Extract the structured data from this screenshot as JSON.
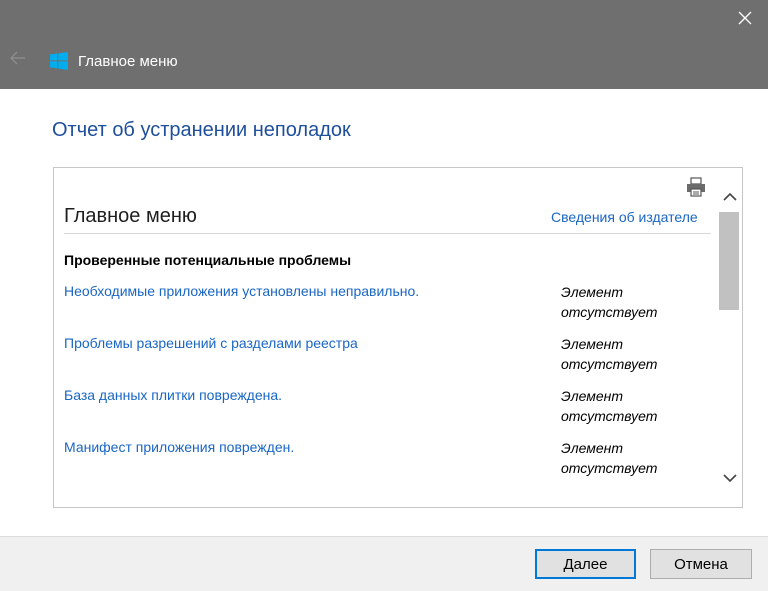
{
  "window": {
    "title": "Главное меню",
    "icons": {
      "close": "close-icon",
      "back": "back-arrow-icon",
      "app": "windows-logo-icon"
    },
    "colors": {
      "titlebar": "#6f6f6f",
      "heading": "#1e4f9c",
      "link": "#1a66c4",
      "logo": "#00adef"
    }
  },
  "page": {
    "heading": "Отчет об устранении неполадок"
  },
  "report": {
    "print_icon": "printer-icon",
    "section_title": "Главное меню",
    "publisher_link": "Сведения об издателе",
    "problems_heading": "Проверенные потенциальные проблемы",
    "problems": [
      {
        "name": "Необходимые приложения установлены неправильно.",
        "status": "Элемент отсутствует"
      },
      {
        "name": "Проблемы разрешений с разделами реестра",
        "status": "Элемент отсутствует"
      },
      {
        "name": "База данных плитки повреждена.",
        "status": "Элемент отсутствует"
      },
      {
        "name": "Манифест приложения поврежден.",
        "status": "Элемент отсутствует"
      }
    ]
  },
  "scrollbar": {
    "up_icon": "chevron-up-icon",
    "down_icon": "chevron-down-icon"
  },
  "footer": {
    "next_label": "Далее",
    "cancel_label": "Отмена"
  }
}
